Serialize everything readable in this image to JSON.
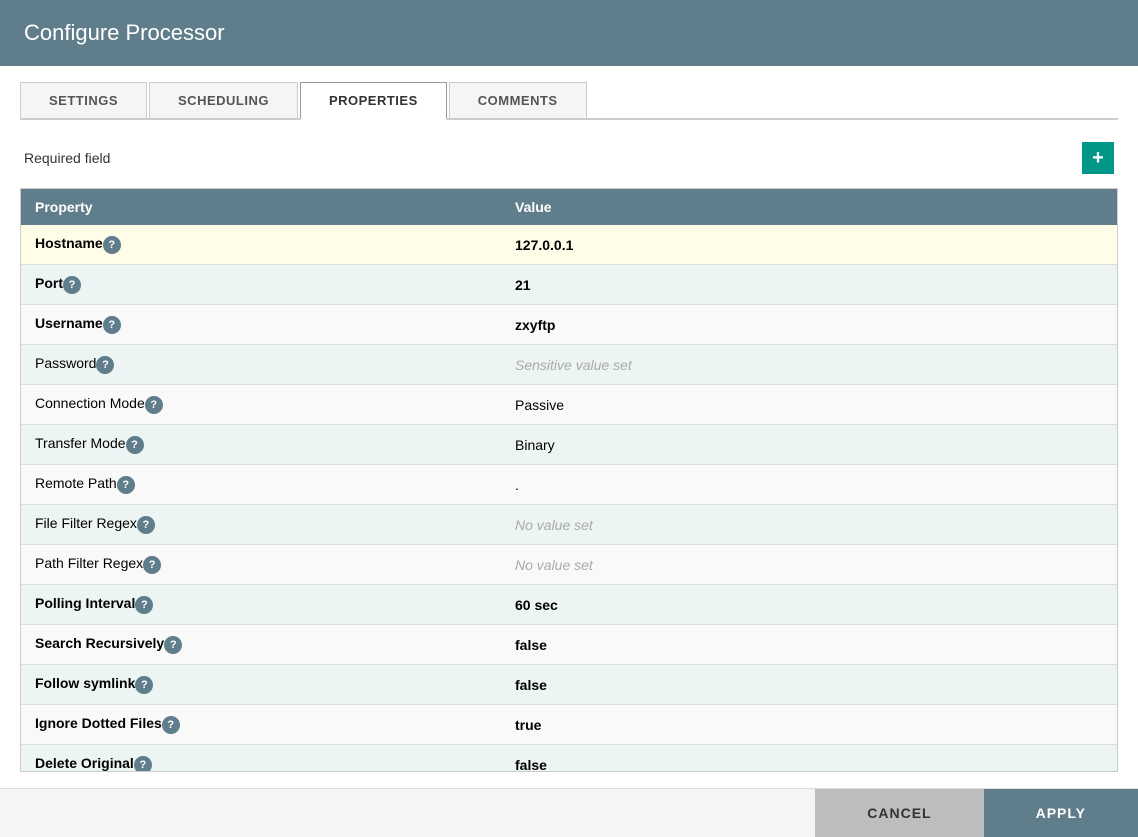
{
  "header": {
    "title": "Configure Processor"
  },
  "tabs": [
    {
      "id": "settings",
      "label": "SETTINGS",
      "active": false
    },
    {
      "id": "scheduling",
      "label": "SCHEDULING",
      "active": false
    },
    {
      "id": "properties",
      "label": "PROPERTIES",
      "active": true
    },
    {
      "id": "comments",
      "label": "COMMENTS",
      "active": false
    }
  ],
  "required_field_label": "Required field",
  "add_button_label": "+",
  "table": {
    "headers": [
      "Property",
      "Value"
    ],
    "rows": [
      {
        "name": "Hostname",
        "bold": true,
        "value": "127.0.0.1",
        "value_bold": true,
        "placeholder": false,
        "highlighted": true
      },
      {
        "name": "Port",
        "bold": true,
        "value": "21",
        "value_bold": true,
        "placeholder": false,
        "highlighted": false
      },
      {
        "name": "Username",
        "bold": true,
        "value": "zxyftp",
        "value_bold": true,
        "placeholder": false,
        "highlighted": false
      },
      {
        "name": "Password",
        "bold": false,
        "value": "Sensitive value set",
        "value_bold": false,
        "placeholder": true,
        "highlighted": false
      },
      {
        "name": "Connection Mode",
        "bold": false,
        "value": "Passive",
        "value_bold": false,
        "placeholder": false,
        "highlighted": false
      },
      {
        "name": "Transfer Mode",
        "bold": false,
        "value": "Binary",
        "value_bold": false,
        "placeholder": false,
        "highlighted": false
      },
      {
        "name": "Remote Path",
        "bold": false,
        "value": ".",
        "value_bold": false,
        "placeholder": false,
        "highlighted": false
      },
      {
        "name": "File Filter Regex",
        "bold": false,
        "value": "No value set",
        "value_bold": false,
        "placeholder": true,
        "highlighted": false
      },
      {
        "name": "Path Filter Regex",
        "bold": false,
        "value": "No value set",
        "value_bold": false,
        "placeholder": true,
        "highlighted": false
      },
      {
        "name": "Polling Interval",
        "bold": true,
        "value": "60 sec",
        "value_bold": true,
        "placeholder": false,
        "highlighted": false
      },
      {
        "name": "Search Recursively",
        "bold": true,
        "value": "false",
        "value_bold": true,
        "placeholder": false,
        "highlighted": false
      },
      {
        "name": "Follow symlink",
        "bold": true,
        "value": "false",
        "value_bold": true,
        "placeholder": false,
        "highlighted": false
      },
      {
        "name": "Ignore Dotted Files",
        "bold": true,
        "value": "true",
        "value_bold": true,
        "placeholder": false,
        "highlighted": false
      },
      {
        "name": "Delete Original",
        "bold": true,
        "value": "false",
        "value_bold": true,
        "placeholder": false,
        "highlighted": false
      }
    ]
  },
  "footer": {
    "cancel_label": "CANCEL",
    "apply_label": "APPLY"
  },
  "icons": {
    "help": "?",
    "add": "+",
    "scroll_up": "▲",
    "scroll_down": "▼"
  }
}
